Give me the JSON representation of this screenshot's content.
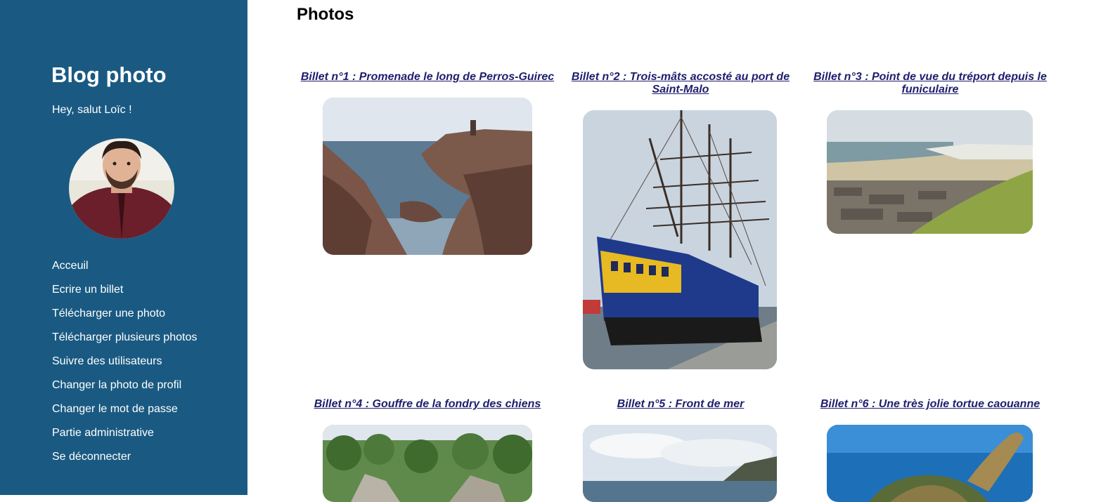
{
  "sidebar": {
    "title": "Blog photo",
    "greeting": "Hey, salut Loïc !",
    "nav": [
      {
        "label": "Acceuil"
      },
      {
        "label": "Ecrire un billet"
      },
      {
        "label": "Télécharger une photo"
      },
      {
        "label": "Télécharger plusieurs photos"
      },
      {
        "label": "Suivre des utilisateurs"
      },
      {
        "label": "Changer la photo de profil"
      },
      {
        "label": "Changer le mot de passe"
      },
      {
        "label": "Partie administrative"
      },
      {
        "label": "Se déconnecter"
      }
    ]
  },
  "main": {
    "title": "Photos",
    "posts": [
      {
        "title": "Billet n°1 : Promenade le long de Perros-Guirec"
      },
      {
        "title": "Billet n°2 : Trois-mâts accosté au port de Saint-Malo"
      },
      {
        "title": "Billet n°3 : Point de vue du tréport depuis le funiculaire"
      },
      {
        "title": "Billet n°4 : Gouffre de la fondry des chiens"
      },
      {
        "title": "Billet n°5 : Front de mer"
      },
      {
        "title": "Billet n°6 : Une très jolie tortue caouanne"
      }
    ]
  },
  "colors": {
    "sidebar_bg": "#1a5a82",
    "link": "#1e1e6e"
  }
}
